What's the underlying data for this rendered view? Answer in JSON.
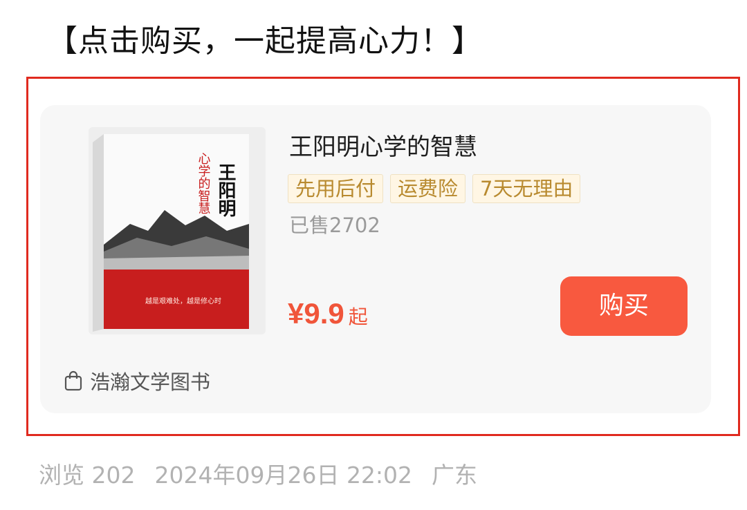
{
  "headline": "【点击购买，一起提高心力！】",
  "product": {
    "title": "王阳明心学的智慧",
    "tags": [
      "先用后付",
      "运费险",
      "7天无理由"
    ],
    "sold": "已售2702",
    "price": "¥9.9",
    "price_suffix": "起",
    "buy_label": "购买",
    "shop_name": "浩瀚文学图书",
    "cover": {
      "big_title": "王阳明",
      "subtitle": "心学的智慧",
      "slogan": "越是艰难处，越是修心时"
    }
  },
  "meta": {
    "views": "浏览 202",
    "datetime": "2024年09月26日 22:02",
    "location": "广东"
  },
  "colors": {
    "frame": "#e02a1f",
    "accent": "#f8593f",
    "price": "#f0553a",
    "tag_bg": "#fff6e4",
    "tag_text": "#b88a2f"
  },
  "icons": {
    "shop": "shopping-bag-icon"
  }
}
